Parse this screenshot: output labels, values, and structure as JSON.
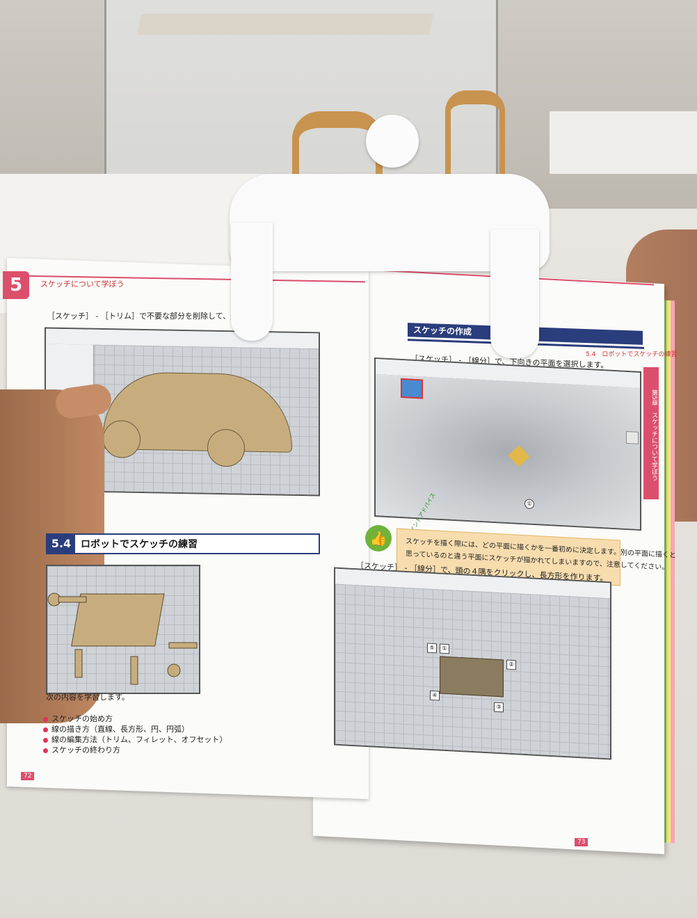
{
  "left_page": {
    "chapter_badge": "5",
    "running_head": "スケッチについて学ぼう",
    "intro_text": "［スケッチ］ - ［トリム］で不要な部分を削除して、完成です。",
    "section_number": "5.4",
    "section_title": "ロボットでスケッチの練習",
    "lead": "次の内容を学習します。",
    "bullets": [
      "スケッチの始め方",
      "線の描き方（直線、長方形、円、円弧）",
      "線の編集方法（トリム、フィレット、オフセット）",
      "スケッチの終わり方"
    ],
    "page_number": "72"
  },
  "right_page": {
    "running_head": "5.4　ロボットでスケッチの練習",
    "side_tab": "第5章　スケッチについて学ぼう",
    "subsection_title": "スケッチの作成",
    "step1_text": "［スケッチ］ - ［線分］で、下向きの平面を選択します。",
    "tip_label": "ワンポイントアドバイス",
    "tip_text_1": "スケッチを描く際には、どの平面に描くかを一番初めに決定します。別の平面に描くと",
    "tip_text_2": "思っているのと違う平面にスケッチが描かれてしまいますので、注意してください。",
    "step2_text": "［スケッチ］ - ［線分］で、頭の４隅をクリックし、長方形を作ります。",
    "callouts": [
      "⑤",
      "①",
      "②",
      "③",
      "④"
    ],
    "step_marker": "①",
    "page_number": "73"
  }
}
